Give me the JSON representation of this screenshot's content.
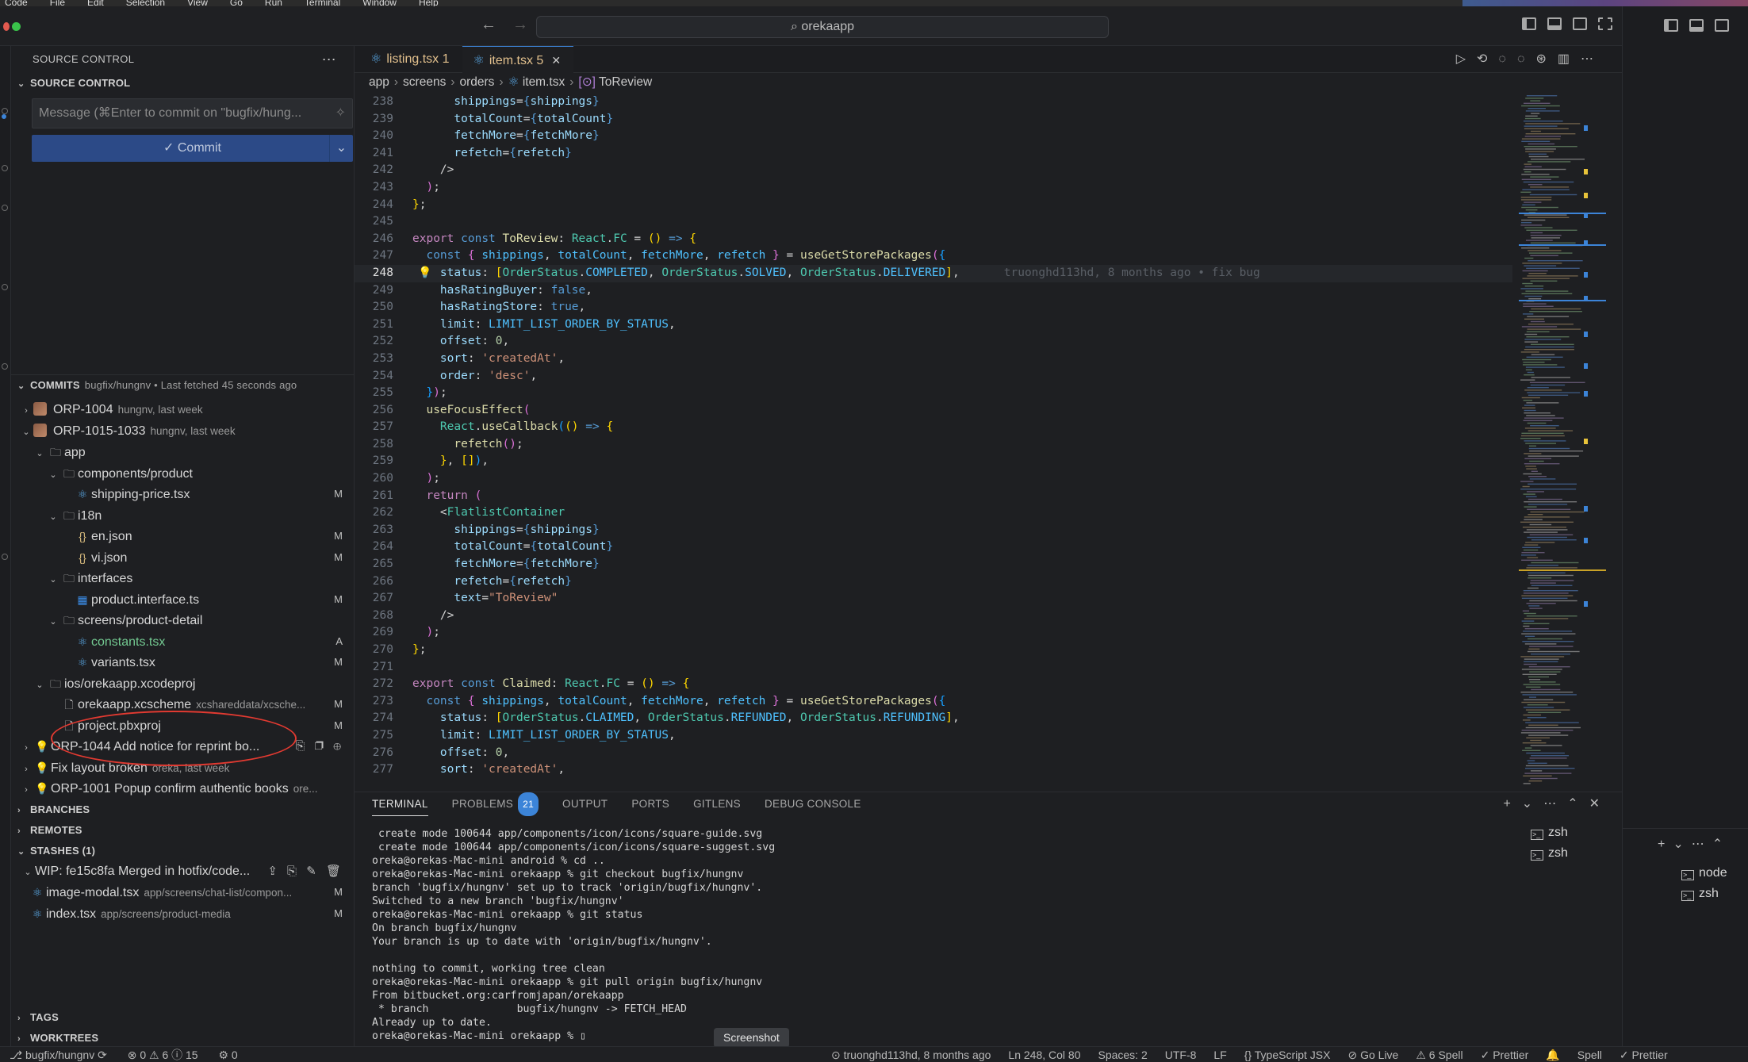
{
  "menubar": {
    "items": [
      "Code",
      "File",
      "Edit",
      "Selection",
      "View",
      "Go",
      "Run",
      "Terminal",
      "Window",
      "Help"
    ]
  },
  "titlebar": {
    "search": "orekaapp",
    "search_icon": "search-icon",
    "back": "←",
    "forward": "→"
  },
  "sidebar": {
    "header": "SOURCE CONTROL",
    "section_source_control": "SOURCE CONTROL",
    "commit_message_placeholder": "Message (⌘Enter to commit on \"bugfix/hung...",
    "commit_button": "✓ Commit",
    "commits": {
      "label": "COMMITS",
      "meta": "bugfix/hungnv • Last fetched 45 seconds ago"
    },
    "tree": [
      {
        "indent": 0,
        "chev": "›",
        "kind": "commit",
        "label": "ORP-1004",
        "meta": "hungnv, last week"
      },
      {
        "indent": 0,
        "chev": "⌄",
        "kind": "commit",
        "label": "ORP-1015-1033",
        "meta": "hungnv, last week"
      },
      {
        "indent": 1,
        "chev": "⌄",
        "kind": "folder",
        "label": "app"
      },
      {
        "indent": 2,
        "chev": "⌄",
        "kind": "folder",
        "label": "components/product"
      },
      {
        "indent": 3,
        "kind": "react",
        "label": "shipping-price.tsx",
        "status": "M"
      },
      {
        "indent": 2,
        "chev": "⌄",
        "kind": "folder",
        "label": "i18n"
      },
      {
        "indent": 3,
        "kind": "json",
        "label": "en.json",
        "status": "M"
      },
      {
        "indent": 3,
        "kind": "json",
        "label": "vi.json",
        "status": "M"
      },
      {
        "indent": 2,
        "chev": "⌄",
        "kind": "folder",
        "label": "interfaces"
      },
      {
        "indent": 3,
        "kind": "ts",
        "label": "product.interface.ts",
        "status": "M"
      },
      {
        "indent": 2,
        "chev": "⌄",
        "kind": "folder",
        "label": "screens/product-detail"
      },
      {
        "indent": 3,
        "kind": "react",
        "label": "constants.tsx",
        "status": "A",
        "added": true
      },
      {
        "indent": 3,
        "kind": "react",
        "label": "variants.tsx",
        "status": "M"
      },
      {
        "indent": 1,
        "chev": "⌄",
        "kind": "folder",
        "label": "ios/orekaapp.xcodeproj"
      },
      {
        "indent": 2,
        "kind": "file",
        "label": "orekaapp.xcscheme",
        "meta": "xcshareddata/xcsche...",
        "status": "M"
      },
      {
        "indent": 2,
        "kind": "file",
        "label": "project.pbxproj",
        "status": "M"
      },
      {
        "indent": 0,
        "chev": "›",
        "kind": "bulb",
        "label": "ORP-1044 Add notice for reprint bo...",
        "actions": "⎘ ❐ ⊕"
      },
      {
        "indent": 0,
        "chev": "›",
        "kind": "bulb",
        "label": "Fix layout broken",
        "meta": "oreka, last week"
      },
      {
        "indent": 0,
        "chev": "›",
        "kind": "bulb",
        "label": "ORP-1001 Popup confirm authentic books",
        "meta": "ore..."
      }
    ],
    "branches": "BRANCHES",
    "remotes": "REMOTES",
    "stashes": "STASHES (1)",
    "stash_item": {
      "label": "WIP: fe15c8fa Merged in hotfix/code...",
      "actions": "⇪ ⎘ ✎ 🗑"
    },
    "stash_files": [
      {
        "label": "image-modal.tsx",
        "meta": "app/screens/chat-list/compon...",
        "status": "M"
      },
      {
        "label": "index.tsx",
        "meta": "app/screens/product-media",
        "status": "M"
      }
    ],
    "tags": "TAGS",
    "worktrees": "WORKTREES"
  },
  "editor": {
    "tabs": [
      {
        "label": "listing.tsx",
        "count": "1",
        "active": false
      },
      {
        "label": "item.tsx",
        "count": "5",
        "active": true
      }
    ],
    "breadcrumb": [
      "app",
      "screens",
      "orders",
      "item.tsx",
      "ToReview"
    ],
    "current_line": 248,
    "blame": "truonghd113hd, 8 months ago • fix bug",
    "lines": [
      [
        238,
        "      <span class='v'>shippings</span><span class='p'>=</span><span class='kb'>{</span><span class='v'>shippings</span><span class='kb'>}</span>"
      ],
      [
        239,
        "      <span class='v'>totalCount</span><span class='p'>=</span><span class='kb'>{</span><span class='v'>totalCount</span><span class='kb'>}</span>"
      ],
      [
        240,
        "      <span class='v'>fetchMore</span><span class='p'>=</span><span class='kb'>{</span><span class='v'>fetchMore</span><span class='kb'>}</span>"
      ],
      [
        241,
        "      <span class='v'>refetch</span><span class='p'>=</span><span class='kb'>{</span><span class='v'>refetch</span><span class='kb'>}</span>"
      ],
      [
        242,
        "    <span class='p'>/&gt;</span>"
      ],
      [
        243,
        "  <span class='br2'>)</span><span class='p'>;</span>"
      ],
      [
        244,
        "<span class='br'>}</span><span class='p'>;</span>"
      ],
      [
        245,
        ""
      ],
      [
        246,
        "<span class='k'>export</span> <span class='kb'>const</span> <span class='f'>ToReview</span><span class='p'>: </span><span class='t'>React</span><span class='p'>.</span><span class='t'>FC</span> <span class='p'>= </span><span class='br'>()</span> <span class='kb'>=&gt;</span> <span class='br'>{</span>"
      ],
      [
        247,
        "  <span class='kb'>const</span> <span class='br2'>{</span> <span class='c'>shippings</span><span class='p'>, </span><span class='c'>totalCount</span><span class='p'>, </span><span class='c'>fetchMore</span><span class='p'>, </span><span class='c'>refetch</span> <span class='br2'>}</span> <span class='p'>= </span><span class='f'>useGetStorePackages</span><span class='br2'>(</span><span class='br3'>{</span>"
      ],
      [
        248,
        "    <span class='v'>status</span><span class='p'>: </span><span class='br'>[</span><span class='t'>OrderStatus</span><span class='p'>.</span><span class='c'>COMPLETED</span><span class='p'>, </span><span class='t'>OrderStatus</span><span class='p'>.</span><span class='c'>SOLVED</span><span class='p'>, </span><span class='t'>OrderStatus</span><span class='p'>.</span><span class='c'>DELIVERED</span><span class='br'>]</span><span class='p'>,</span>"
      ],
      [
        249,
        "    <span class='v'>hasRatingBuyer</span><span class='p'>: </span><span class='kb'>false</span><span class='p'>,</span>"
      ],
      [
        250,
        "    <span class='v'>hasRatingStore</span><span class='p'>: </span><span class='kb'>true</span><span class='p'>,</span>"
      ],
      [
        251,
        "    <span class='v'>limit</span><span class='p'>: </span><span class='c'>LIMIT_LIST_ORDER_BY_STATUS</span><span class='p'>,</span>"
      ],
      [
        252,
        "    <span class='v'>offset</span><span class='p'>: </span><span class='n'>0</span><span class='p'>,</span>"
      ],
      [
        253,
        "    <span class='v'>sort</span><span class='p'>: </span><span class='s'>'createdAt'</span><span class='p'>,</span>"
      ],
      [
        254,
        "    <span class='v'>order</span><span class='p'>: </span><span class='s'>'desc'</span><span class='p'>,</span>"
      ],
      [
        255,
        "  <span class='br3'>}</span><span class='br2'>)</span><span class='p'>;</span>"
      ],
      [
        256,
        "  <span class='f'>useFocusEffect</span><span class='br2'>(</span>"
      ],
      [
        257,
        "    <span class='t'>React</span><span class='p'>.</span><span class='f'>useCallback</span><span class='br3'>(</span><span class='br'>()</span> <span class='kb'>=&gt;</span> <span class='br'>{</span>"
      ],
      [
        258,
        "      <span class='f'>refetch</span><span class='br2'>()</span><span class='p'>;</span>"
      ],
      [
        259,
        "    <span class='br'>}</span><span class='p'>, </span><span class='br'>[]</span><span class='br3'>)</span><span class='p'>,</span>"
      ],
      [
        260,
        "  <span class='br2'>)</span><span class='p'>;</span>"
      ],
      [
        261,
        "  <span class='k'>return</span> <span class='br2'>(</span>"
      ],
      [
        262,
        "    <span class='p'>&lt;</span><span class='tg'>FlatlistContainer</span>"
      ],
      [
        263,
        "      <span class='v'>shippings</span><span class='p'>=</span><span class='kb'>{</span><span class='v'>shippings</span><span class='kb'>}</span>"
      ],
      [
        264,
        "      <span class='v'>totalCount</span><span class='p'>=</span><span class='kb'>{</span><span class='v'>totalCount</span><span class='kb'>}</span>"
      ],
      [
        265,
        "      <span class='v'>fetchMore</span><span class='p'>=</span><span class='kb'>{</span><span class='v'>fetchMore</span><span class='kb'>}</span>"
      ],
      [
        266,
        "      <span class='v'>refetch</span><span class='p'>=</span><span class='kb'>{</span><span class='v'>refetch</span><span class='kb'>}</span>"
      ],
      [
        267,
        "      <span class='v'>text</span><span class='p'>=</span><span class='s'>\"ToReview\"</span>"
      ],
      [
        268,
        "    <span class='p'>/&gt;</span>"
      ],
      [
        269,
        "  <span class='br2'>)</span><span class='p'>;</span>"
      ],
      [
        270,
        "<span class='br'>}</span><span class='p'>;</span>"
      ],
      [
        271,
        ""
      ],
      [
        272,
        "<span class='k'>export</span> <span class='kb'>const</span> <span class='f'>Claimed</span><span class='p'>: </span><span class='t'>React</span><span class='p'>.</span><span class='t'>FC</span> <span class='p'>= </span><span class='br'>()</span> <span class='kb'>=&gt;</span> <span class='br'>{</span>"
      ],
      [
        273,
        "  <span class='kb'>const</span> <span class='br2'>{</span> <span class='c'>shippings</span><span class='p'>, </span><span class='c'>totalCount</span><span class='p'>, </span><span class='c'>fetchMore</span><span class='p'>, </span><span class='c'>refetch</span> <span class='br2'>}</span> <span class='p'>= </span><span class='f'>useGetStorePackages</span><span class='br2'>(</span><span class='br3'>{</span>"
      ],
      [
        274,
        "    <span class='v'>status</span><span class='p'>: </span><span class='br'>[</span><span class='t'>OrderStatus</span><span class='p'>.</span><span class='c'>CLAIMED</span><span class='p'>, </span><span class='t'>OrderStatus</span><span class='p'>.</span><span class='c'>REFUNDED</span><span class='p'>, </span><span class='t'>OrderStatus</span><span class='p'>.</span><span class='c'>REFUNDING</span><span class='br'>]</span><span class='p'>,</span>"
      ],
      [
        275,
        "    <span class='v'>limit</span><span class='p'>: </span><span class='c'>LIMIT_LIST_ORDER_BY_STATUS</span><span class='p'>,</span>"
      ],
      [
        276,
        "    <span class='v'>offset</span><span class='p'>: </span><span class='n'>0</span><span class='p'>,</span>"
      ],
      [
        277,
        "    <span class='v'>sort</span><span class='p'>: </span><span class='s'>'createdAt'</span><span class='p'>,</span>"
      ]
    ]
  },
  "panel": {
    "tabs": [
      "TERMINAL",
      "PROBLEMS",
      "OUTPUT",
      "PORTS",
      "GITLENS",
      "DEBUG CONSOLE"
    ],
    "problems_count": "21",
    "terminal_lines": [
      {
        "dot": "",
        "text": " create mode 100644 app/components/icon/icons/square-guide.svg"
      },
      {
        "dot": "",
        "text": " create mode 100644 app/components/icon/icons/square-suggest.svg"
      },
      {
        "dot": "blue",
        "text": "oreka@orekas-Mac-mini android % cd .."
      },
      {
        "dot": "blue",
        "text": "oreka@orekas-Mac-mini orekaapp % git checkout bugfix/hungnv"
      },
      {
        "dot": "",
        "text": "branch 'bugfix/hungnv' set up to track 'origin/bugfix/hungnv'."
      },
      {
        "dot": "",
        "text": "Switched to a new branch 'bugfix/hungnv'"
      },
      {
        "dot": "blue",
        "text": "oreka@orekas-Mac-mini orekaapp % git status"
      },
      {
        "dot": "",
        "text": "On branch bugfix/hungnv"
      },
      {
        "dot": "",
        "text": "Your branch is up to date with 'origin/bugfix/hungnv'."
      },
      {
        "dot": "",
        "text": ""
      },
      {
        "dot": "",
        "text": "nothing to commit, working tree clean"
      },
      {
        "dot": "blue",
        "text": "oreka@orekas-Mac-mini orekaapp % git pull origin bugfix/hungnv"
      },
      {
        "dot": "",
        "text": "From bitbucket.org:carfromjapan/orekaapp"
      },
      {
        "dot": "",
        "text": " * branch              bugfix/hungnv -> FETCH_HEAD"
      },
      {
        "dot": "",
        "text": "Already up to date."
      },
      {
        "dot": "hollow",
        "text": "oreka@orekas-Mac-mini orekaapp % ▯"
      }
    ],
    "terminal_list": [
      "zsh",
      "zsh"
    ],
    "right_terminal_list": [
      "node",
      "zsh"
    ],
    "tooltip": "Screenshot"
  },
  "statusbar": {
    "left": [
      "⎇ bugfix/hungnv ⟳",
      "⊗ 0 ⚠ 6 ⓘ 15",
      "⚙ 0"
    ],
    "right": [
      "⊙ truonghd113hd, 8 months ago",
      "Ln 248, Col 80",
      "Spaces: 2",
      "UTF-8",
      "LF",
      "{} TypeScript JSX",
      "⊘ Go Live",
      "⚠ 6 Spell",
      "✓ Prettier",
      "🔔",
      "Spell",
      "✓ Prettier"
    ]
  },
  "colors": {
    "accent": "#3c84d8",
    "annotation": "#e23a31",
    "commit_button": "#2c4a87"
  }
}
